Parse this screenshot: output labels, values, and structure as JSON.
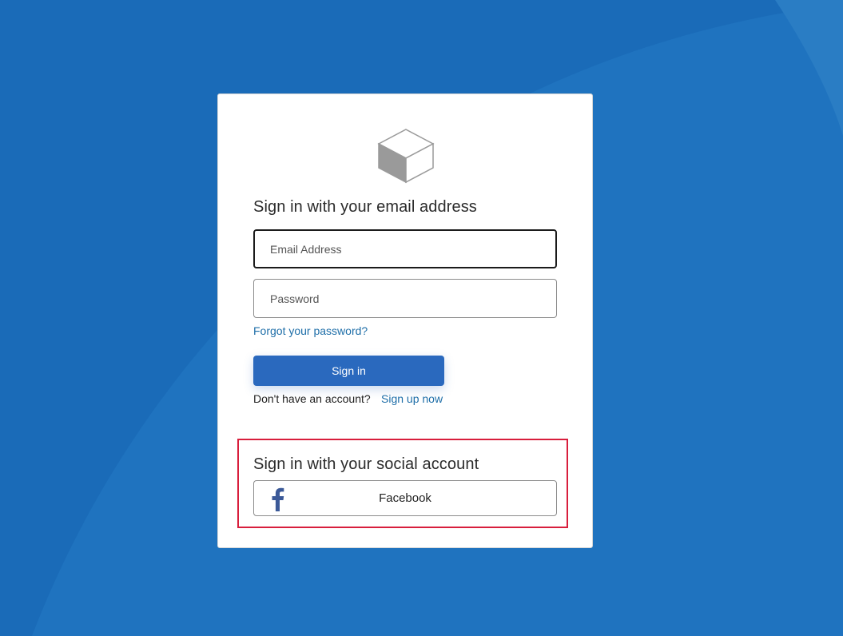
{
  "signin": {
    "heading": "Sign in with your email address",
    "email_placeholder": "Email Address",
    "password_placeholder": "Password",
    "forgot_link": "Forgot your password?",
    "signin_button": "Sign in",
    "no_account_text": "Don't have an account?",
    "signup_link": "Sign up now"
  },
  "social": {
    "heading": "Sign in with your social account",
    "providers": [
      {
        "label": "Facebook",
        "icon": "facebook-icon"
      }
    ]
  },
  "icons": {
    "logo": "cube-logo-icon"
  },
  "colors": {
    "background": "#1a6bb8",
    "primary_button": "#2a69be",
    "link": "#1e6ea8",
    "highlight_border": "#d81e3c",
    "facebook": "#3b5998"
  }
}
